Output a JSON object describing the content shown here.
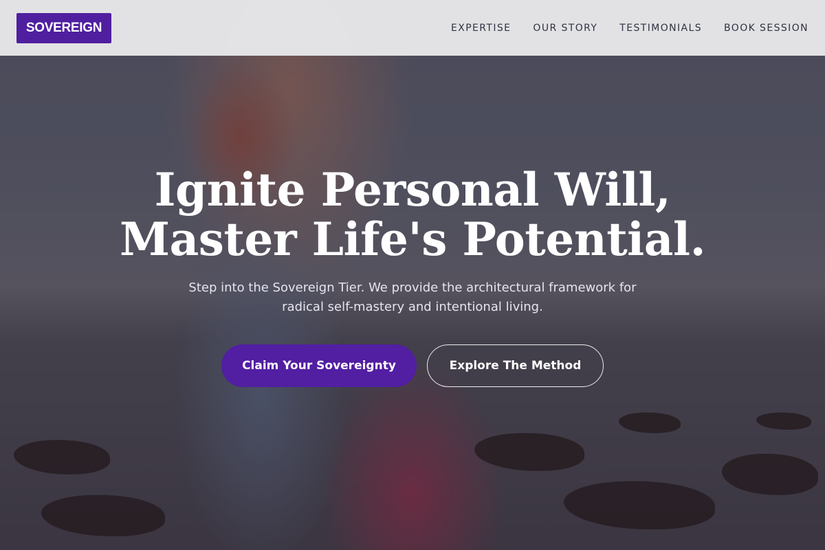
{
  "brand": {
    "logo_text": "SOVEREIGN",
    "accent": "#521ea2"
  },
  "nav": {
    "items": [
      {
        "label": "EXPERTISE"
      },
      {
        "label": "OUR STORY"
      },
      {
        "label": "TESTIMONIALS"
      },
      {
        "label": "BOOK SESSION"
      }
    ]
  },
  "hero": {
    "headline_line1": "Ignite Personal Will,",
    "headline_line2": "Master Life's Potential.",
    "subheadline": "Step into the Sovereign Tier. We provide the architectural framework for radical self-mastery and intentional living.",
    "primary_cta": "Claim Your Sovereignty",
    "secondary_cta": "Explore The Method"
  }
}
